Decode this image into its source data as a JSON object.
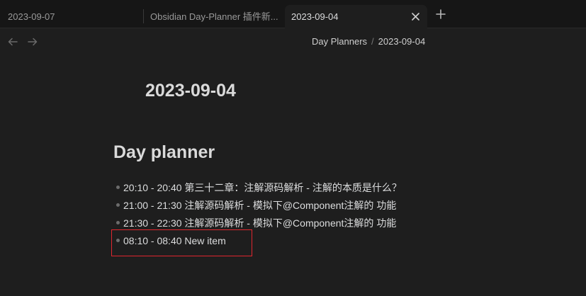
{
  "tabs": [
    {
      "label": "2023-09-07",
      "active": false
    },
    {
      "label": "Obsidian Day-Planner 插件新...",
      "active": false
    },
    {
      "label": "2023-09-04",
      "active": true
    }
  ],
  "icons": {
    "close": "close-icon",
    "new_tab": "plus-icon",
    "back": "arrow-left-icon",
    "forward": "arrow-right-icon"
  },
  "breadcrumb": {
    "folder": "Day Planners",
    "separator": "/",
    "file": "2023-09-04"
  },
  "document": {
    "title": "2023-09-04",
    "heading": "Day planner",
    "items": [
      "20:10 - 20:40 第三十二章：注解源码解析 - 注解的本质是什么？",
      "21:00 - 21:30 注解源码解析 - 模拟下@Component注解的 功能",
      "21:30 - 22:30 注解源码解析 - 模拟下@Component注解的 功能",
      "08:10 - 08:40 New item"
    ]
  },
  "colors": {
    "background": "#1e1e1e",
    "tabbar": "#161616",
    "highlight": "#e0262e"
  }
}
